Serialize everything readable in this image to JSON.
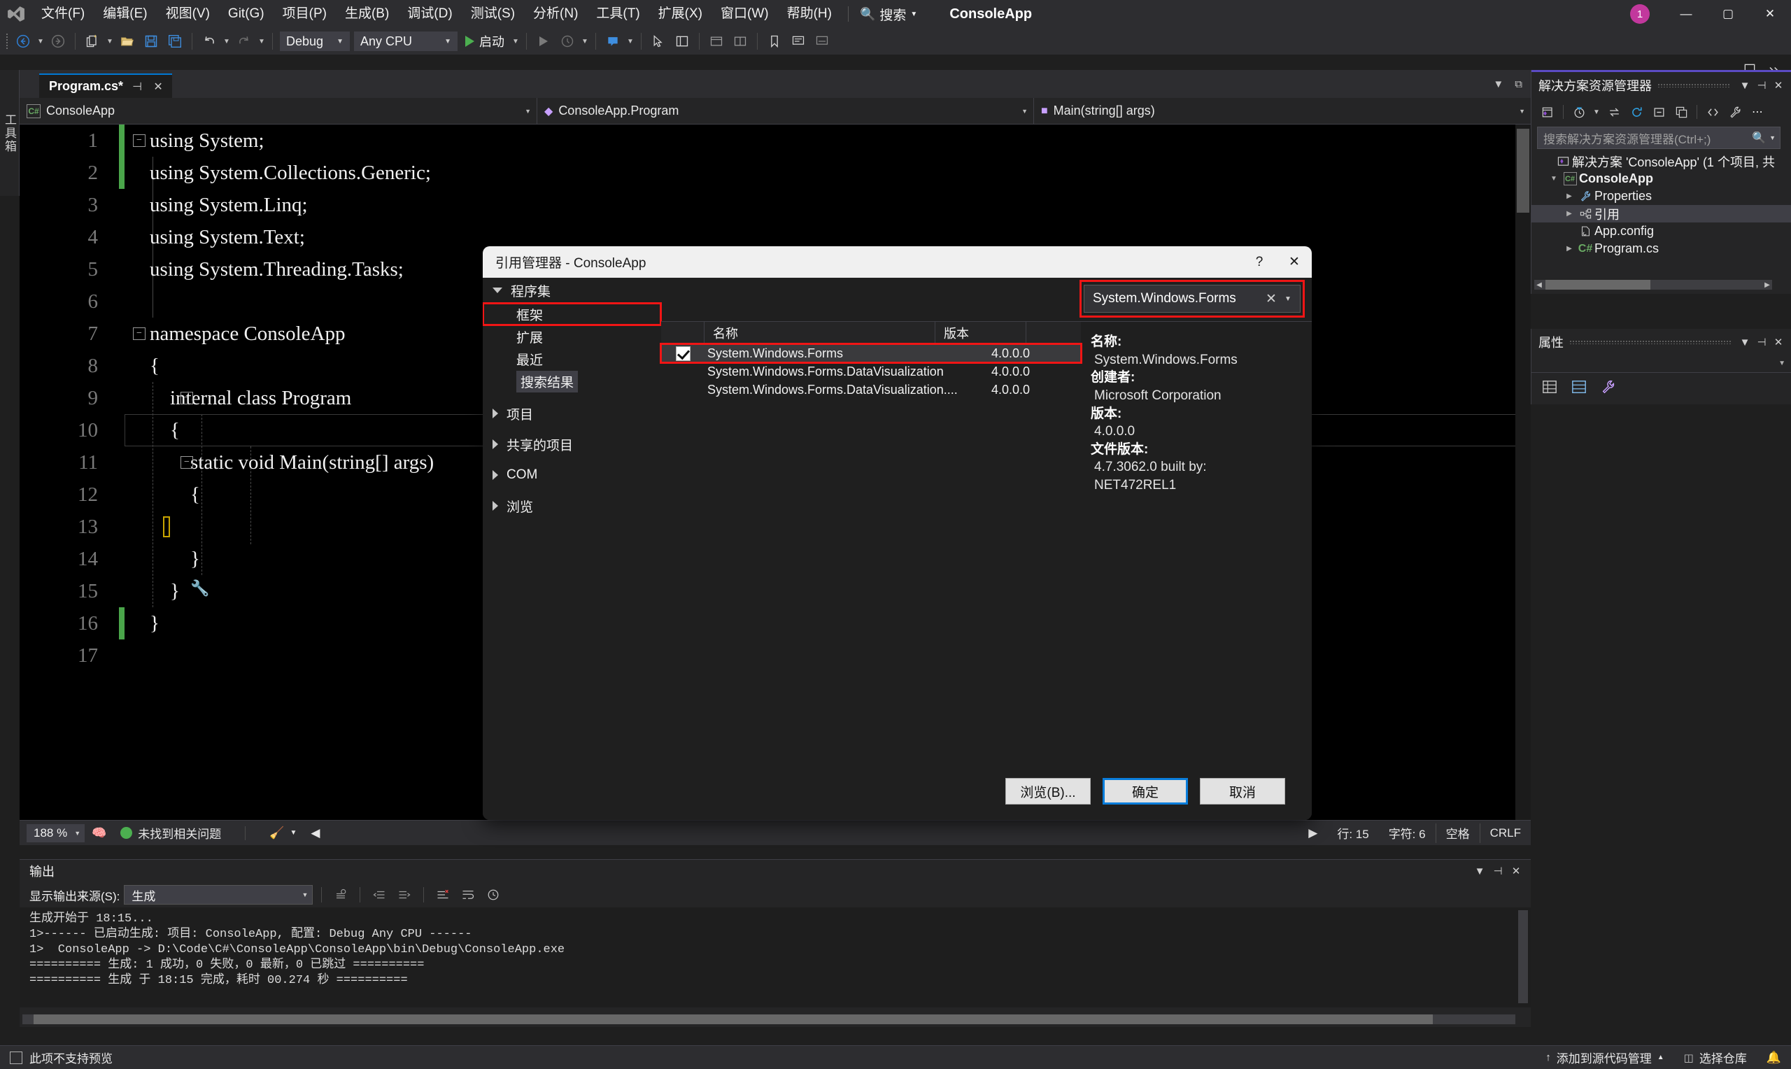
{
  "menubar": {
    "logo": "vs-logo",
    "items": [
      "文件(F)",
      "编辑(E)",
      "视图(V)",
      "Git(G)",
      "项目(P)",
      "生成(B)",
      "调试(D)",
      "测试(S)",
      "分析(N)",
      "工具(T)",
      "扩展(X)",
      "窗口(W)",
      "帮助(H)"
    ],
    "search_label": "搜索",
    "app_title": "ConsoleApp",
    "notification_count": "1",
    "minimize": "—",
    "maximize": "▢",
    "close": "✕"
  },
  "toolbar": {
    "nav_back": "back-arrow",
    "nav_forward": "forward-arrow",
    "new_item": "new-item",
    "open_file": "open-folder",
    "save": "save",
    "save_all": "save-all",
    "undo": "undo",
    "redo": "redo",
    "configuration": "Debug",
    "platform": "Any CPU",
    "start_label": "启动"
  },
  "toolbox_tab": "工具箱",
  "editor": {
    "tab_name": "Program.cs*",
    "pin": "⊣",
    "close": "✕",
    "nav_project": "ConsoleApp",
    "nav_type": "ConsoleApp.Program",
    "nav_member": "Main(string[] args)",
    "lines": [
      {
        "n": "1",
        "text": "using System;",
        "fold": "−",
        "change": "green"
      },
      {
        "n": "2",
        "text": "using System.Collections.Generic;",
        "change": "green"
      },
      {
        "n": "3",
        "text": "using System.Linq;",
        "change": "none"
      },
      {
        "n": "4",
        "text": "using System.Text;",
        "change": "none"
      },
      {
        "n": "5",
        "text": "using System.Threading.Tasks;",
        "change": "none"
      },
      {
        "n": "6",
        "text": "",
        "change": "none"
      },
      {
        "n": "7",
        "text": "namespace ConsoleApp",
        "fold": "−",
        "change": "none"
      },
      {
        "n": "8",
        "text": "{",
        "change": "none"
      },
      {
        "n": "9",
        "text": "    internal class Program",
        "fold": "−",
        "change": "none"
      },
      {
        "n": "10",
        "text": "    {",
        "change": "none"
      },
      {
        "n": "11",
        "text": "        static void Main(string[] args)",
        "fold": "−",
        "change": "none"
      },
      {
        "n": "12",
        "text": "        {",
        "change": "none"
      },
      {
        "n": "13",
        "text": "",
        "change": "none"
      },
      {
        "n": "14",
        "text": "        }",
        "change": "none"
      },
      {
        "n": "15",
        "text": "    }",
        "change": "none"
      },
      {
        "n": "16",
        "text": "}",
        "change": "green"
      },
      {
        "n": "17",
        "text": "",
        "change": "none"
      }
    ],
    "status": {
      "zoom": "188 %",
      "issues": "未找到相关问题",
      "line": "行: 15",
      "char": "字符: 6",
      "spaces": "空格",
      "eol": "CRLF"
    }
  },
  "solution_explorer": {
    "title": "解决方案资源管理器",
    "search_placeholder": "搜索解决方案资源管理器(Ctrl+;)",
    "tree": [
      {
        "label": "解决方案 'ConsoleApp' (1 个项目, 共",
        "icon": "solution-icon",
        "indent": 0,
        "expander": "",
        "bold": false
      },
      {
        "label": "ConsoleApp",
        "icon": "csharp-project-icon",
        "indent": 1,
        "expander": "▼",
        "bold": true
      },
      {
        "label": "Properties",
        "icon": "wrench-icon",
        "indent": 2,
        "expander": "▶",
        "bold": false
      },
      {
        "label": "引用",
        "icon": "references-icon",
        "indent": 2,
        "expander": "▶",
        "bold": false,
        "selected": true
      },
      {
        "label": "App.config",
        "icon": "config-icon",
        "indent": 3,
        "expander": "",
        "bold": false
      },
      {
        "label": "Program.cs",
        "icon": "csharp-file-icon",
        "indent": 2,
        "expander": "▶",
        "bold": false
      }
    ]
  },
  "properties_panel": {
    "title": "属性"
  },
  "output_panel": {
    "title": "输出",
    "source_label": "显示输出来源(S):",
    "source_value": "生成",
    "lines": [
      "生成开始于 18:15...",
      "1>------ 已启动生成: 项目: ConsoleApp, 配置: Debug Any CPU ------",
      "1>  ConsoleApp -> D:\\Code\\C#\\ConsoleApp\\ConsoleApp\\bin\\Debug\\ConsoleApp.exe",
      "========== 生成: 1 成功，0 失败，0 最新，0 已跳过 ==========",
      "========== 生成 于 18:15 完成，耗时 00.274 秒 =========="
    ]
  },
  "statusbar": {
    "left_text": "此项不支持预览",
    "source_control": "添加到源代码管理",
    "repo": "选择仓库"
  },
  "dialog": {
    "title": "引用管理器 - ConsoleApp",
    "help": "?",
    "close": "✕",
    "tree": {
      "group1": "程序集",
      "children": [
        "框架",
        "扩展",
        "最近",
        "搜索结果"
      ],
      "highlighted_child": "框架",
      "chip_child": "搜索结果",
      "group2": "项目",
      "group3": "共享的项目",
      "group4": "COM",
      "group5": "浏览"
    },
    "search_value": "System.Windows.Forms",
    "search_clear": "✕",
    "columns": [
      "名称",
      "版本"
    ],
    "rows": [
      {
        "checked": true,
        "name": "System.Windows.Forms",
        "version": "4.0.0.0",
        "selected": true,
        "highlighted": true
      },
      {
        "checked": false,
        "name": "System.Windows.Forms.DataVisualization",
        "version": "4.0.0.0"
      },
      {
        "checked": false,
        "name": "System.Windows.Forms.DataVisualization....",
        "version": "4.0.0.0"
      }
    ],
    "detail": {
      "name_key": "名称:",
      "name_val": "System.Windows.Forms",
      "author_key": "创建者:",
      "author_val": "Microsoft Corporation",
      "version_key": "版本:",
      "version_val": "4.0.0.0",
      "fileversion_key": "文件版本:",
      "fileversion_val1": "4.7.3062.0 built by:",
      "fileversion_val2": "NET472REL1"
    },
    "buttons": {
      "browse": "浏览(B)...",
      "ok": "确定",
      "cancel": "取消"
    }
  },
  "colors": {
    "accent": "#0078d4",
    "highlight_red": "#f01515",
    "success_green": "#4caf50",
    "panel_purple": "#5b4bc4"
  }
}
